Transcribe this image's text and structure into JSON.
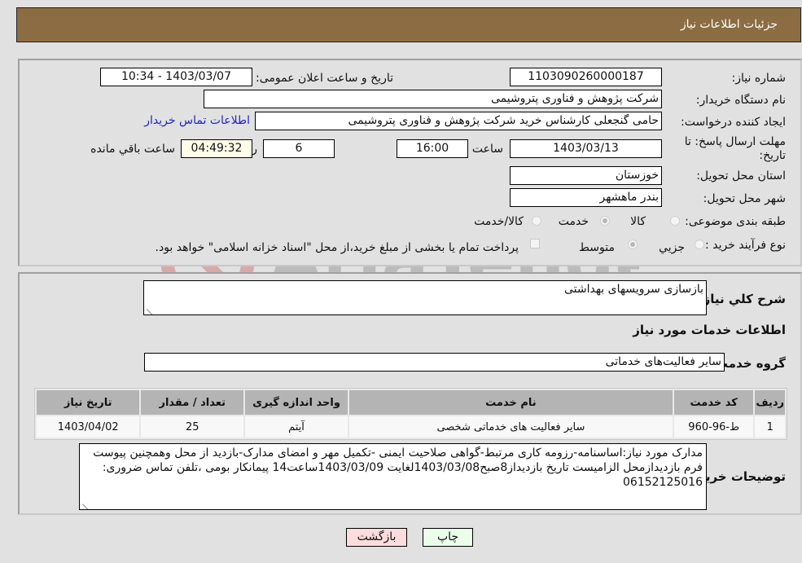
{
  "header": {
    "title": "جزئیات اطلاعات نیاز"
  },
  "fields": {
    "need_number": {
      "label": "شماره نیاز:",
      "value": "1103090260000187"
    },
    "announce_datetime": {
      "label": "تاریخ و ساعت اعلان عمومی:",
      "value": "1403/03/07 - 10:34"
    },
    "buyer_org": {
      "label": "نام دستگاه خریدار:",
      "value": "شرکت پژوهش و فناوری پتروشیمی"
    },
    "requester": {
      "label": "ایجاد کننده درخواست:",
      "value": "حامی گنجعلی کارشناس خرید شرکت پژوهش و فناوری پتروشیمی"
    },
    "buyer_contact_link": "اطلاعات تماس خریدار",
    "deadline": {
      "label": "مهلت ارسال پاسخ: تا تاریخ:",
      "date": "1403/03/13",
      "time_label": "ساعت",
      "time": "16:00",
      "days": "6",
      "days_label": "روز و",
      "remaining": "04:49:32",
      "remaining_label": "ساعت باقي مانده"
    },
    "province": {
      "label": "استان محل تحویل:",
      "value": "خوزستان"
    },
    "city": {
      "label": "شهر محل تحویل:",
      "value": "بندر ماهشهر"
    },
    "category": {
      "label": "طبقه بندی موضوعی:",
      "options": [
        "کالا",
        "خدمت",
        "کالا/خدمت"
      ],
      "selected": "خدمت"
    },
    "process": {
      "label": "نوع فرآیند خرید :",
      "options": [
        "جزيي",
        "متوسط"
      ],
      "selected": "متوسط",
      "payment_note": "پرداخت تمام یا بخشی از مبلغ خرید،از محل \"اسناد خزانه اسلامی\" خواهد بود.",
      "payment_checked": false
    }
  },
  "details": {
    "summary_label": "شرح کلي نیاز:",
    "summary_value": "بازسازی سرویسهای بهداشتی",
    "services_heading": "اطلاعات خدمات مورد نیاز",
    "service_group_label": "گروه خدمت:",
    "service_group_value": "سایر فعالیت‌های خدماتی",
    "table": {
      "headers": [
        "ردیف",
        "کد خدمت",
        "نام خدمت",
        "واحد اندازه گیری",
        "تعداد / مقدار",
        "تاریخ نیاز"
      ],
      "rows": [
        [
          "1",
          "ط-96-960",
          "سایر فعالیت های خدماتی شخصی",
          "آیتم",
          "25",
          "1403/04/02"
        ]
      ]
    },
    "buyer_notes_label": "توضیحات خریدار:",
    "buyer_notes": "مدارک مورد نیاز:اساسنامه-رزومه کاری مرتبط-گواهی صلاحیت ایمنی -تکمیل مهر و امضای مدارک-بازدید از محل وهمچنین پیوست فرم بازدیدازمحل الزامیست تاریخ بازدیداز8صبح1403/03/08لغایت 1403/03/09ساعت14 پیمانکار بومی ،تلفن تماس ضروری: 06152125016"
  },
  "buttons": {
    "print": "چاپ",
    "back": "بازگشت"
  },
  "watermark": "AriaTender.neT"
}
